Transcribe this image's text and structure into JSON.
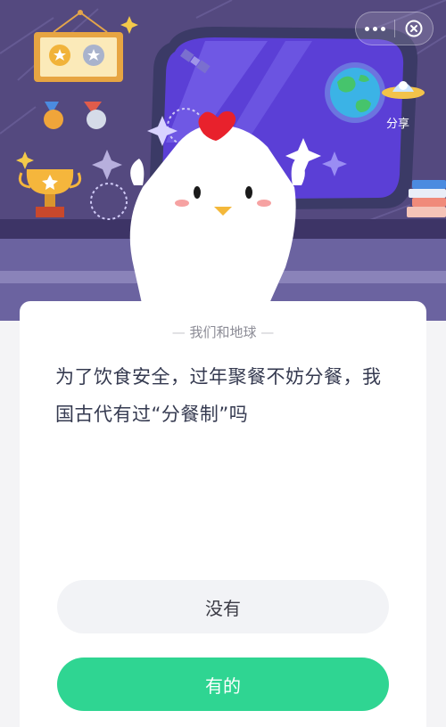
{
  "top_bar": {
    "more_icon": "more-dots-icon",
    "close_icon": "close-circle-icon"
  },
  "scene": {
    "share_label": "分享",
    "colors": {
      "background": "#54497f",
      "window": "#5b3fd6",
      "floor": "#6b63a0"
    }
  },
  "card": {
    "category": "我们和地球",
    "question": "为了饮食安全，过年聚餐不妨分餐，我国古代有过“分餐制”吗",
    "options": [
      {
        "label": "没有"
      },
      {
        "label": "有的"
      }
    ],
    "colors": {
      "primary": "#2fd592",
      "secondary": "#f2f3f6"
    }
  }
}
